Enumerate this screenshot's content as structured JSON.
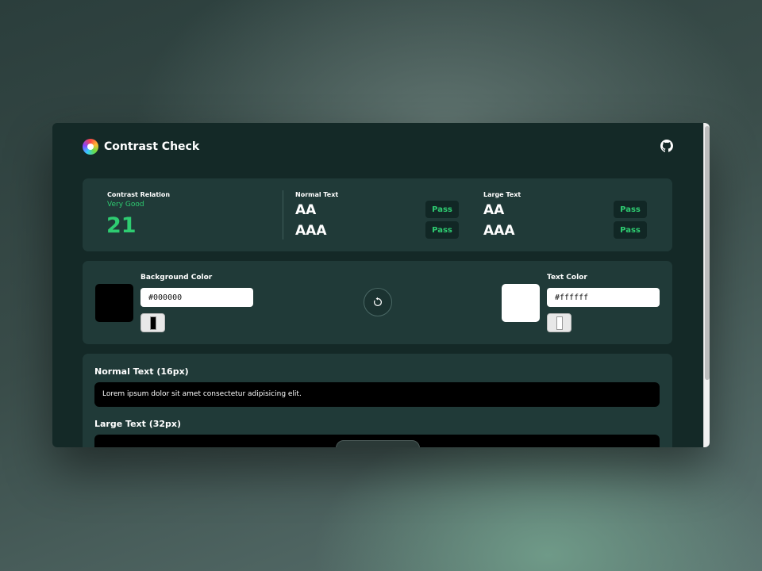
{
  "app": {
    "title": "Contrast Check"
  },
  "header": {
    "repo_icon": "github-icon"
  },
  "score": {
    "label": "Contrast Relation",
    "rating": "Very Good",
    "value": "21"
  },
  "normal_text": {
    "label": "Normal Text",
    "levels": [
      {
        "level": "AA",
        "result": "Pass"
      },
      {
        "level": "AAA",
        "result": "Pass"
      }
    ]
  },
  "large_text": {
    "label": "Large Text",
    "levels": [
      {
        "level": "AA",
        "result": "Pass"
      },
      {
        "level": "AAA",
        "result": "Pass"
      }
    ]
  },
  "background": {
    "label": "Background Color",
    "value": "#000000",
    "swatch_color": "#000000"
  },
  "text_color": {
    "label": "Text Color",
    "value": "#ffffff",
    "swatch_color": "#ffffff"
  },
  "swap": {
    "icon": "rotate-icon"
  },
  "preview": {
    "normal_title": "Normal Text (16px)",
    "normal_sample": "Lorem ipsum dolor sit amet consectetur adipisicing elit.",
    "large_title": "Large Text (32px)"
  },
  "colors": {
    "page": "#142927",
    "card": "#203a38",
    "pass": "#2ecc71"
  }
}
